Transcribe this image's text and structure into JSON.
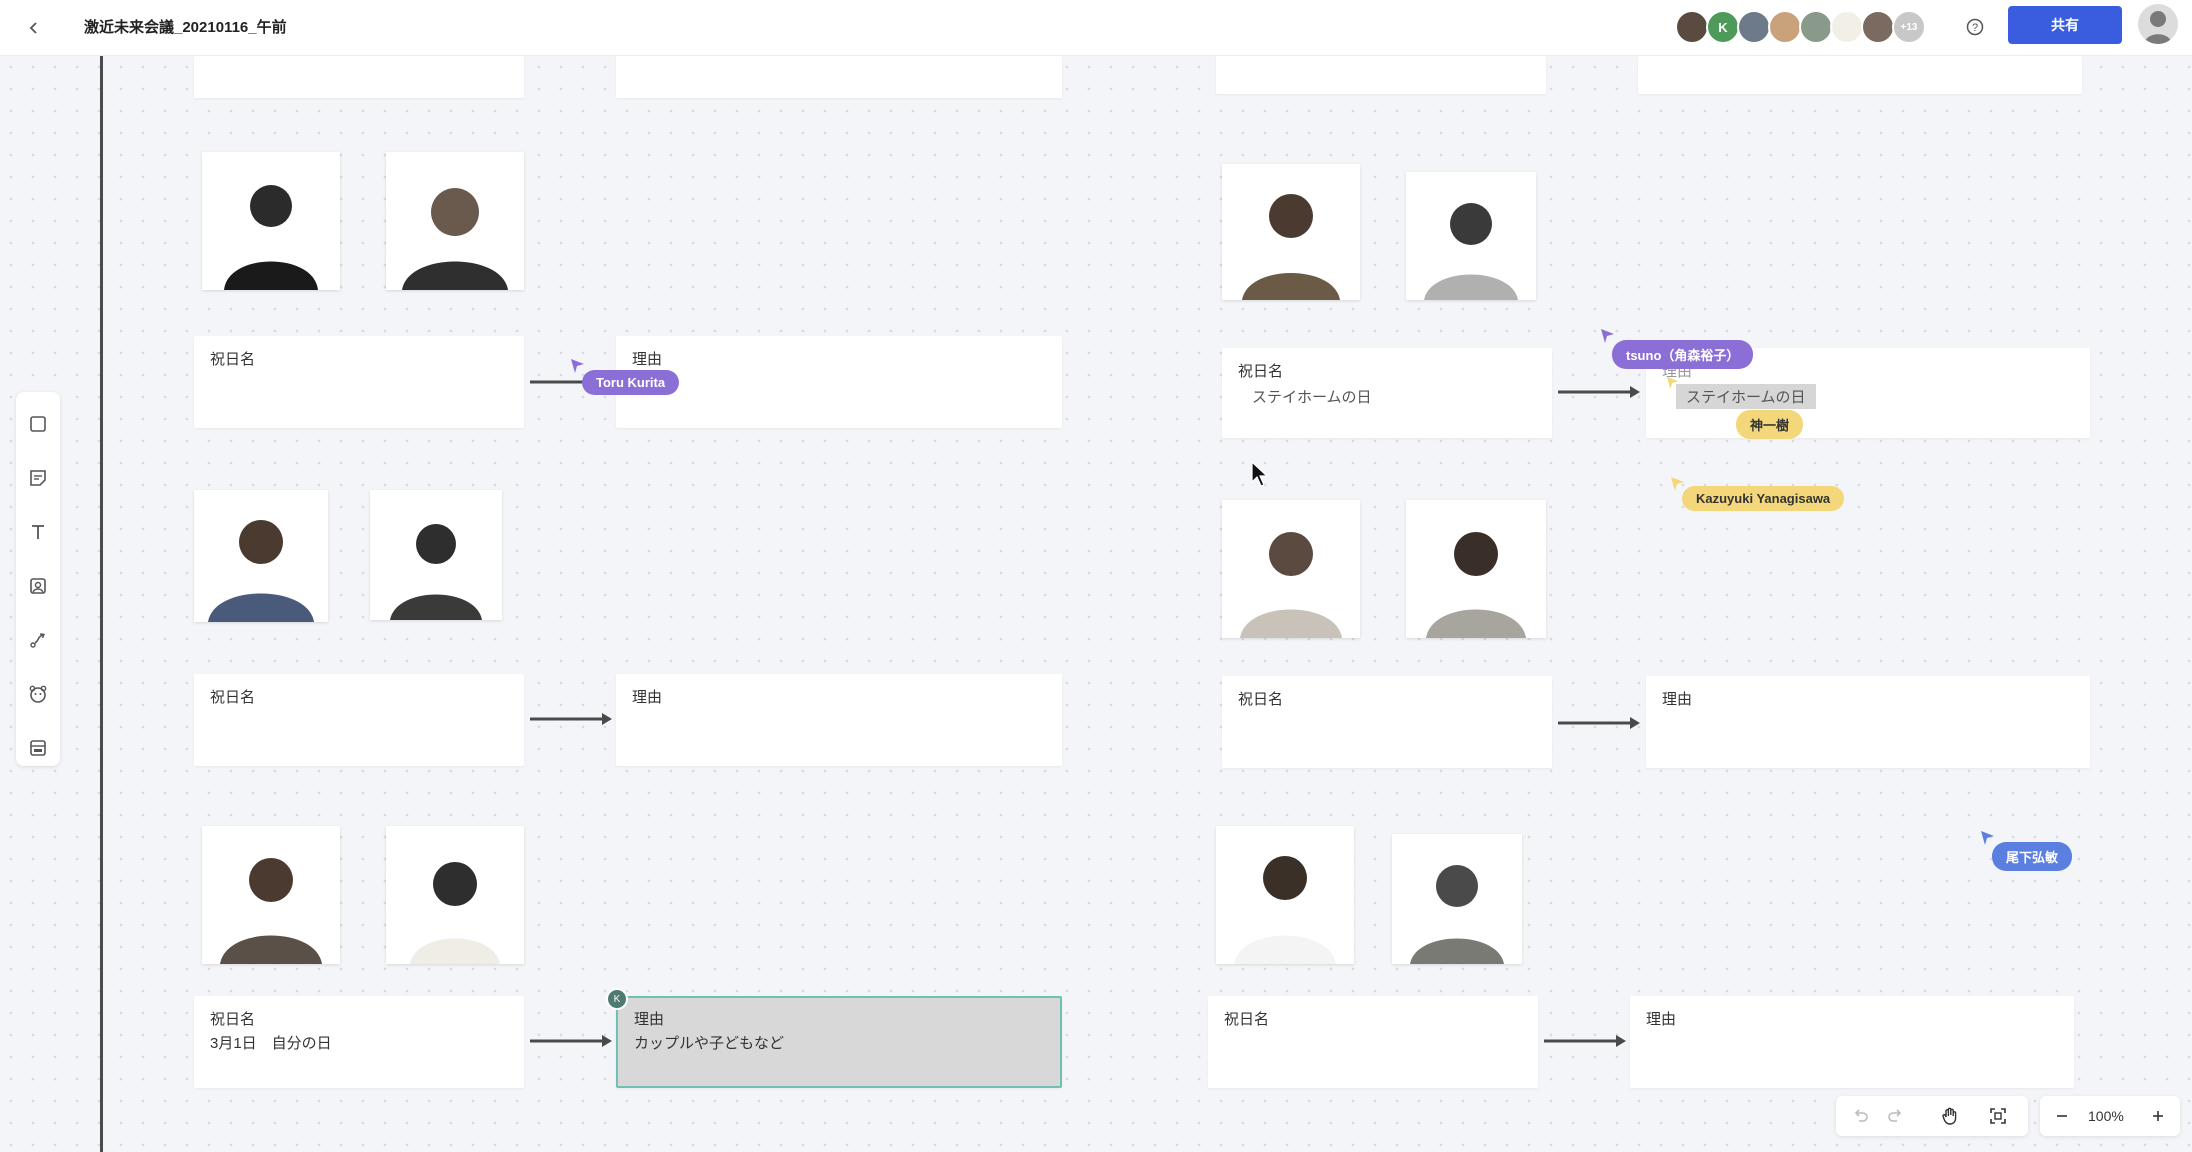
{
  "header": {
    "title": "激近未来会議_20210116_午前",
    "share_label": "共有",
    "collaborators": [
      {
        "initial": "",
        "color": "#5b4a3f"
      },
      {
        "initial": "K",
        "color": "#4e9a5a"
      },
      {
        "initial": "",
        "color": "#6d7a8a"
      },
      {
        "initial": "",
        "color": "#c9a27c"
      },
      {
        "initial": "",
        "color": "#8a9a8a"
      },
      {
        "initial": "",
        "color": "#f2efe6"
      },
      {
        "initial": "",
        "color": "#7a6a60"
      },
      {
        "initial": "+13",
        "color": "#c8c8c8"
      }
    ]
  },
  "toolbar": {
    "tools": [
      "square-icon",
      "sticky-note-icon",
      "text-icon",
      "image-icon",
      "connector-icon",
      "bear-icon",
      "template-icon"
    ]
  },
  "board": {
    "cards": [
      {
        "label": "",
        "value": ""
      },
      {
        "label": "",
        "value": ""
      },
      {
        "label": "",
        "value": ""
      },
      {
        "label": "",
        "value": ""
      },
      {
        "label": "祝日名",
        "value": ""
      },
      {
        "label": "理由",
        "value": ""
      },
      {
        "label": "祝日名",
        "value": "ステイホームの日"
      },
      {
        "label": "理由",
        "value": "ステイホームの日"
      },
      {
        "label": "祝日名",
        "value": ""
      },
      {
        "label": "理由",
        "value": ""
      },
      {
        "label": "祝日名",
        "value": ""
      },
      {
        "label": "理由",
        "value": ""
      },
      {
        "label": "祝日名",
        "value": "3月1日　自分の日"
      },
      {
        "label": "理由",
        "value": "カップルや子どもなど"
      },
      {
        "label": "祝日名",
        "value": ""
      },
      {
        "label": "理由",
        "value": ""
      }
    ],
    "cursors": [
      {
        "name": "Toru Kurita",
        "color": "#8b6fd6",
        "text_color": "#ffffff"
      },
      {
        "name": "tsuno（角森裕子）",
        "color": "#8b6fd6",
        "text_color": "#ffffff"
      },
      {
        "name": "神一樹",
        "color": "#f3d77a",
        "text_color": "#333333"
      },
      {
        "name": "Kazuyuki Yanagisawa",
        "color": "#f3d77a",
        "text_color": "#333333"
      },
      {
        "name": "尾下弘敏",
        "color": "#5b7fe0",
        "text_color": "#ffffff"
      }
    ],
    "selection_badge": "K"
  },
  "zoom": {
    "level": "100%"
  }
}
